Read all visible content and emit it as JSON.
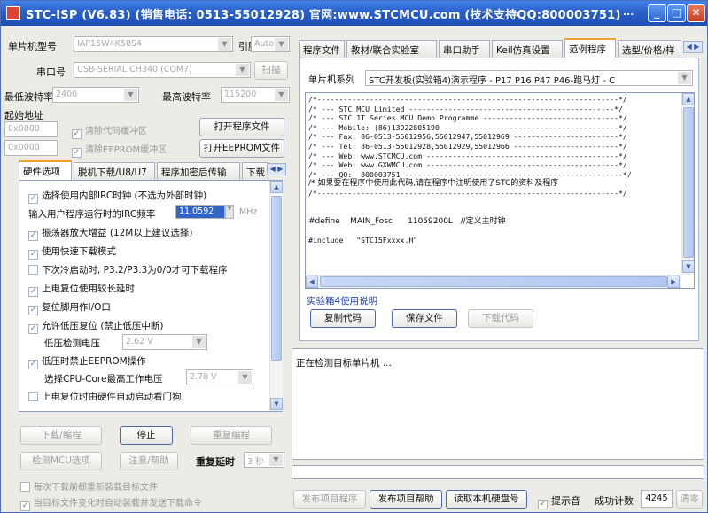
{
  "titlebar": {
    "title": "STC-ISP (V6.83) (销售电话: 0513-55012928) 官网:www.STCMCU.com (技术支持QQ:800003751)",
    "more": "..."
  },
  "left": {
    "mcu_model_label": "单片机型号",
    "mcu_model_value": "IAP15W4K58S4",
    "pin_label": "引脚数",
    "pin_value": "Auto",
    "port_label": "串口号",
    "port_value": "USB-SERIAL CH340 (COM7)",
    "scan_button": "扫描",
    "min_baud_label": "最低波特率",
    "min_baud_value": "2400",
    "max_baud_label": "最高波特率",
    "max_baud_value": "115200",
    "start_addr_label": "起始地址",
    "code_addr_value": "0x0000",
    "clear_code_label": "清除代码缓冲区",
    "open_prog_button": "打开程序文件",
    "eeprom_addr_value": "0x0000",
    "clear_eeprom_label": "清除EEPROM缓冲区",
    "open_eeprom_button": "打开EEPROM文件",
    "tabs": [
      "硬件选项",
      "脱机下载/U8/U7",
      "程序加密后传输",
      "下载"
    ],
    "options": [
      {
        "label": "选择使用内部IRC时钟 (不选为外部时钟)",
        "checked": true
      },
      {
        "label": "输入用户程序运行时的IRC频率",
        "value": "11.0592",
        "unit": "MHz"
      },
      {
        "label": "振荡器放大增益 (12M以上建议选择)",
        "checked": true
      },
      {
        "label": "使用快速下载模式",
        "checked": true
      },
      {
        "label": "下次冷启动时, P3.2/P3.3为0/0才可下载程序",
        "checked": false
      },
      {
        "label": "上电复位使用较长延时",
        "checked": true
      },
      {
        "label": "复位脚用作I/O口",
        "checked": true
      },
      {
        "label": "允许低压复位 (禁止低压中断)",
        "checked": true
      },
      {
        "label": "低压检测电压",
        "value": "2.62 V"
      },
      {
        "label": "低压时禁止EEPROM操作",
        "checked": true
      },
      {
        "label": "选择CPU-Core最高工作电压",
        "value": "2.78 V"
      },
      {
        "label": "上电复位时由硬件自动启动看门狗",
        "checked": false
      }
    ],
    "download_button": "下载/编程",
    "stop_button": "停止",
    "reprogram_button": "重复编程",
    "check_mcu_button": "检测MCU选项",
    "help_button": "注意/帮助",
    "repeat_delay_label": "重复延时",
    "repeat_delay_value": "3 秒",
    "reload_label": "每次下载前都重新装载目标文件",
    "auto_send_label": "当目标文件变化时自动装载并发送下载命令"
  },
  "right": {
    "tabs": [
      "程序文件",
      "教材/联合实验室",
      "串口助手",
      "Keil仿真设置",
      "范例程序",
      "选型/价格/样"
    ],
    "series_label": "单片机系列",
    "series_value": "STC开发板(实验箱4)演示程序 - P17 P16 P47 P46-跑马灯 - C",
    "code_lines": [
      "/*---------------------------------------------------------------------*/",
      "/* --- STC MCU Limited -----------------------------------------------*/",
      "/* --- STC 1T Series MCU Demo Programme -------------------------------*/",
      "/* --- Mobile: (86)13922805190 ----------------------------------------*/",
      "/* --- Fax: 86-0513-55012956,55012947,55012969 ------------------------*/",
      "/* --- Tel: 86-0513-55012928,55012929,55012966 ------------------------*/",
      "/* --- Web: www.STCMCU.com --------------------------------------------*/",
      "/* --- Web: www.GXWMCU.com --------------------------------------------*/",
      "/* --- QQ:  800003751 --------------------------------------------------*/",
      "/* 如果要在程序中使用此代码,请在程序中注明使用了STC的资料及程序",
      "/*---------------------------------------------------------------------*/",
      "",
      "",
      "#define    MAIN_Fosc      11059200L   //定义主时钟",
      "",
      "#include   \"STC15Fxxxx.H\""
    ],
    "exp_link": "实验箱4使用说明",
    "copy_button": "复制代码",
    "save_button": "保存文件",
    "download_code_button": "下载代码",
    "status_text": "正在检测目标单片机 ...",
    "publish_button": "发布项目程序",
    "publish_help_button": "发布项目帮助",
    "read_disk_button": "读取本机硬盘号",
    "sound_label": "提示音",
    "success_label": "成功计数",
    "success_count": "4245",
    "clear_button": "清零"
  }
}
